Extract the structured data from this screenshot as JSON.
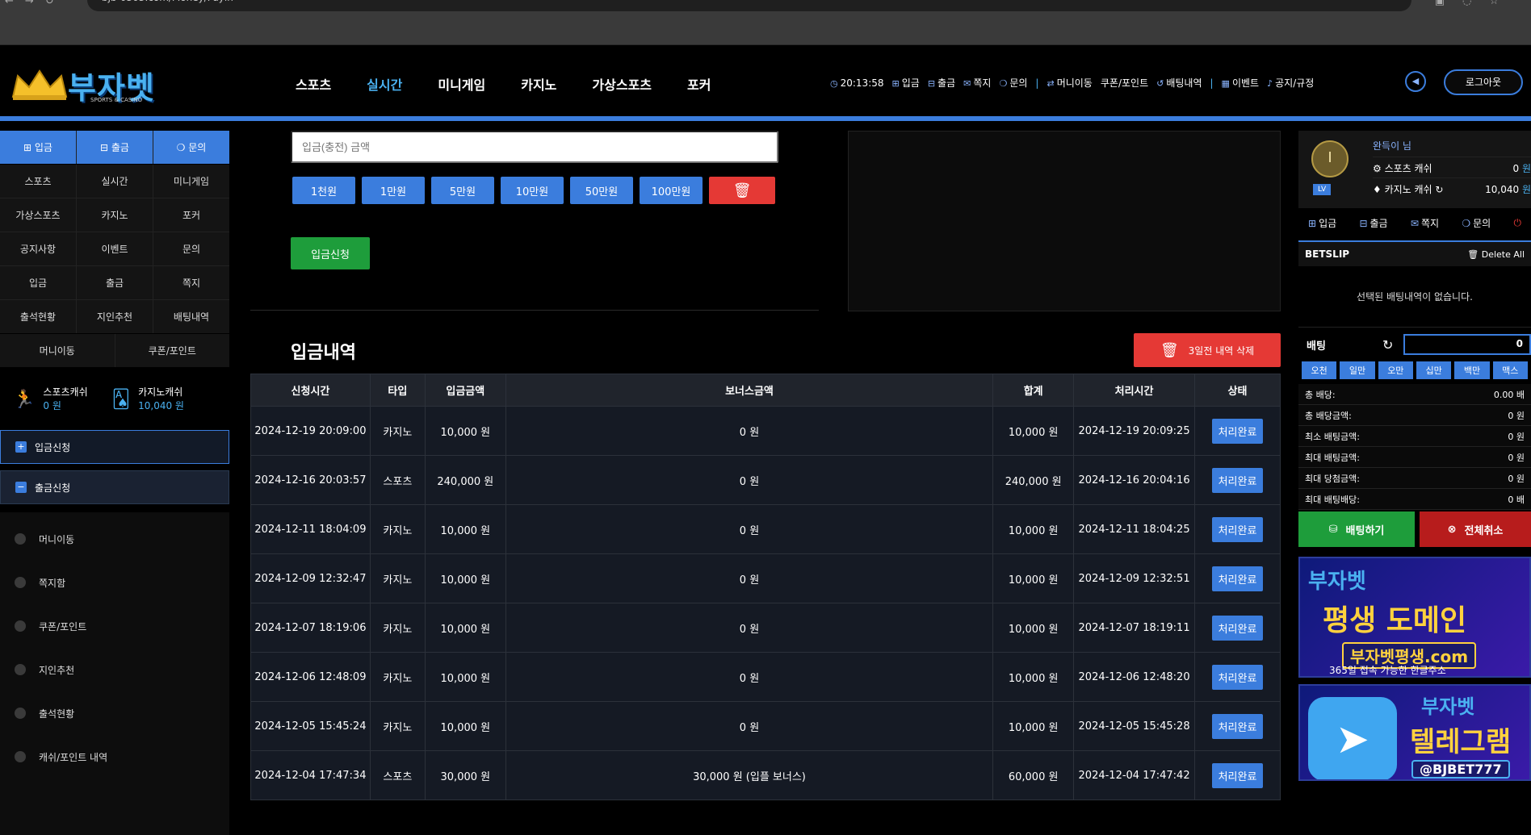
{
  "browser": {
    "url": "bjb-0303.com/Money/Payin"
  },
  "header": {
    "brand": "부자벳",
    "brand_sub": "SPORTS & CASINO",
    "main_nav": [
      "스포츠",
      "실시간",
      "미니게임",
      "카지노",
      "가상스포츠",
      "포커"
    ],
    "active_nav": "실시간",
    "clock": "20:13:58",
    "top_links": [
      "입금",
      "출금",
      "쪽지",
      "문의",
      "머니이동",
      "쿠폰/포인트",
      "배팅내역",
      "이벤트",
      "공지/규정"
    ],
    "logout": "로그아웃"
  },
  "left": {
    "top_buttons": [
      "입금",
      "출금",
      "문의"
    ],
    "grid": [
      "스포츠",
      "실시간",
      "미니게임",
      "가상스포츠",
      "카지노",
      "포커",
      "공지사항",
      "이벤트",
      "문의",
      "입금",
      "출금",
      "쪽지",
      "출석현황",
      "지인추천",
      "배팅내역"
    ],
    "grid2": [
      "머니이동",
      "쿠폰/포인트"
    ],
    "sports_cash_label": "스포츠캐쉬",
    "sports_cash_value": "0 원",
    "casino_cash_label": "카지노캐쉬",
    "casino_cash_value": "10,040 원",
    "deposit_request": "입금신청",
    "withdraw_request": "출금신청",
    "sub_items": [
      "머니이동",
      "쪽지함",
      "쿠폰/포인트",
      "지인추천",
      "출석현황",
      "캐쉬/포인트 내역"
    ]
  },
  "main": {
    "amount_placeholder": "입금(충전) 금액",
    "chips": [
      "1천원",
      "1만원",
      "5만원",
      "10만원",
      "50만원",
      "100만원"
    ],
    "apply": "입금신청",
    "history_title": "입금내역",
    "delete_old": "3일전 내역 삭제",
    "columns": [
      "신청시간",
      "타입",
      "입금금액",
      "보너스금액",
      "합계",
      "처리시간",
      "상태"
    ],
    "rows": [
      [
        "2024-12-19 20:09:00",
        "카지노",
        "10,000 원",
        "0 원",
        "10,000 원",
        "2024-12-19 20:09:25",
        "처리완료"
      ],
      [
        "2024-12-16 20:03:57",
        "스포츠",
        "240,000 원",
        "0 원",
        "240,000 원",
        "2024-12-16 20:04:16",
        "처리완료"
      ],
      [
        "2024-12-11 18:04:09",
        "카지노",
        "10,000 원",
        "0 원",
        "10,000 원",
        "2024-12-11 18:04:25",
        "처리완료"
      ],
      [
        "2024-12-09 12:32:47",
        "카지노",
        "10,000 원",
        "0 원",
        "10,000 원",
        "2024-12-09 12:32:51",
        "처리완료"
      ],
      [
        "2024-12-07 18:19:06",
        "카지노",
        "10,000 원",
        "0 원",
        "10,000 원",
        "2024-12-07 18:19:11",
        "처리완료"
      ],
      [
        "2024-12-06 12:48:09",
        "카지노",
        "10,000 원",
        "0 원",
        "10,000 원",
        "2024-12-06 12:48:20",
        "처리완료"
      ],
      [
        "2024-12-05 15:45:24",
        "카지노",
        "10,000 원",
        "0 원",
        "10,000 원",
        "2024-12-05 15:45:28",
        "처리완료"
      ],
      [
        "2024-12-04 17:47:34",
        "스포츠",
        "30,000 원",
        "30,000 원 (입플 보너스)",
        "60,000 원",
        "2024-12-04 17:47:42",
        "처리완료"
      ]
    ]
  },
  "right": {
    "username": "완득이 님",
    "level": "LV",
    "sports_cash_label": "스포츠 캐쉬",
    "sports_cash_value": "0",
    "casino_cash_label": "카지노 캐쉬",
    "casino_cash_value": "10,040",
    "unit": "원",
    "links": [
      "입금",
      "출금",
      "쪽지",
      "문의"
    ],
    "betslip_title": "BETSLIP",
    "delete_all": "Delete All",
    "empty_msg": "선택된 배팅내역이 없습니다.",
    "bet_label": "배팅",
    "bet_value": "0",
    "quick": [
      "오천",
      "일만",
      "오만",
      "십만",
      "백만",
      "맥스"
    ],
    "stats": [
      {
        "label": "총 배당:",
        "value": "0.00 배"
      },
      {
        "label": "총 배당금액:",
        "value": "0 원"
      },
      {
        "label": "최소 배팅금액:",
        "value": "0 원"
      },
      {
        "label": "최대 배팅금액:",
        "value": "0 원"
      },
      {
        "label": "최대 당첨금액:",
        "value": "0 원"
      },
      {
        "label": "최대 배팅배당:",
        "value": "0 배"
      }
    ],
    "bet_button": "배팅하기",
    "cancel_button": "전체취소",
    "banner1": {
      "brand": "부자벳",
      "title": "평생 도메인",
      "domain": "부자벳평생.com",
      "note": "365일 접속 가능한 한글주소"
    },
    "banner2": {
      "brand": "부자벳",
      "title": "텔레그램",
      "handle": "@BJBET777"
    }
  }
}
